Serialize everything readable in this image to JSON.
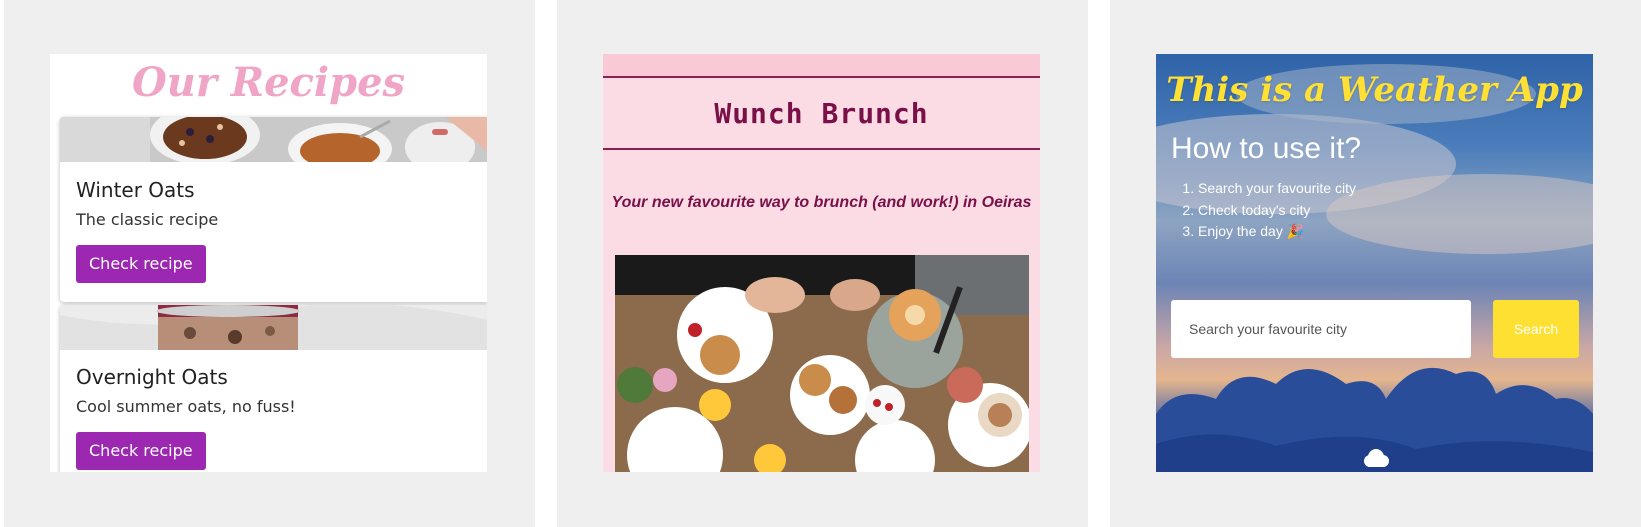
{
  "recipes": {
    "title": "Our Recipes",
    "cards": [
      {
        "name": "Winter Oats",
        "description": "The classic recipe",
        "button": "Check recipe"
      },
      {
        "name": "Overnight Oats",
        "description": "Cool summer oats, no fuss!",
        "button": "Check recipe"
      }
    ],
    "accent_color": "#9c27b0",
    "title_color": "#f0a4c6"
  },
  "brunch": {
    "title": "Wunch Brunch",
    "tagline": "Your new favourite way to brunch (and work!) in Oeiras",
    "text_color": "#7a1048",
    "background_color": "#fbdbe4"
  },
  "weather": {
    "title": "This is a Weather App",
    "subtitle": "How to use it?",
    "steps": [
      "Search your favourite city",
      "Check today's city",
      "Enjoy the day 🎉"
    ],
    "search_placeholder": "Search your favourite city",
    "search_button": "Search",
    "accent_color": "#fde031",
    "weather_icon": "cloud-icon"
  }
}
